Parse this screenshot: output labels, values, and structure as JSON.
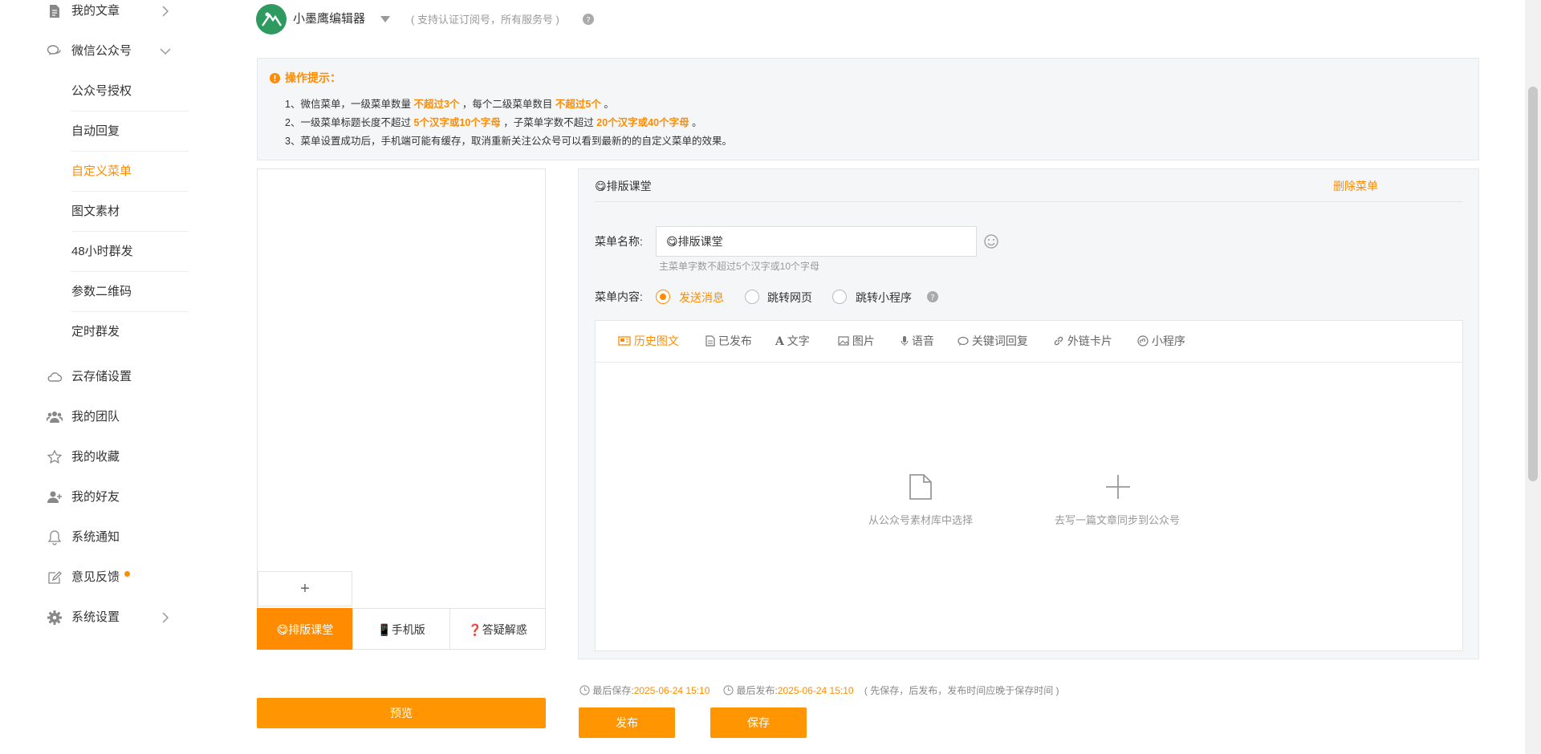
{
  "sidebar": {
    "my_articles": "我的文章",
    "wechat": "微信公众号",
    "sub_items": [
      "公众号授权",
      "自动回复",
      "自定义菜单",
      "图文素材",
      "48小时群发",
      "参数二维码",
      "定时群发"
    ],
    "cloud_storage": "云存储设置",
    "my_team": "我的团队",
    "favorites": "我的收藏",
    "friends": "我的好友",
    "notifications": "系统通知",
    "feedback": "意见反馈",
    "settings": "系统设置"
  },
  "account": {
    "name": "小墨鹰编辑器",
    "hint": "( 支持认证订阅号，所有服务号 )"
  },
  "tips": {
    "title": "操作提示：",
    "l1a": "1、微信菜单，一级菜单数量",
    "l1b": "不超过3个",
    "l1c": "，每个二级菜单数目",
    "l1d": "不超过5个",
    "l1e": "。",
    "l2a": "2、一级菜单标题长度不超过",
    "l2b": "5个汉字或10个字母",
    "l2c": "，子菜单字数不超过",
    "l2d": "20个汉字或40个字母",
    "l2e": "。",
    "l3": "3、菜单设置成功后，手机端可能有缓存，取消重新关注公众号可以看到最新的的自定义菜单的效果。"
  },
  "phone": {
    "plus": "+",
    "menu": [
      "😋排版课堂",
      "📱手机版",
      "❓答疑解惑"
    ]
  },
  "editor": {
    "header_title": "😋排版课堂",
    "delete_menu": "删除菜单",
    "name_label": "菜单名称:",
    "name_value": "😋排版课堂",
    "name_hint": "主菜单字数不超过5个汉字或10个字母",
    "content_label": "菜单内容:",
    "radio_options": [
      "发送消息",
      "跳转网页",
      "跳转小程序"
    ],
    "tabs": [
      "历史图文",
      "已发布",
      "文字",
      "图片",
      "语音",
      "关键词回复",
      "外链卡片",
      "小程序"
    ],
    "choose_material": "从公众号素材库中选择",
    "write_article": "去写一篇文章同步到公众号"
  },
  "footer": {
    "preview": "预览",
    "last_save_label": "最后保存:",
    "last_save_time": "2025-06-24 15:10",
    "last_publish_label": "最后发布:",
    "last_publish_time": "2025-06-24 15:10",
    "note": "( 先保存，后发布，发布时间应晚于保存时间 )",
    "publish": "发布",
    "save": "保存"
  },
  "colors": {
    "accent": "#ff8c00",
    "button": "#ff9500"
  }
}
